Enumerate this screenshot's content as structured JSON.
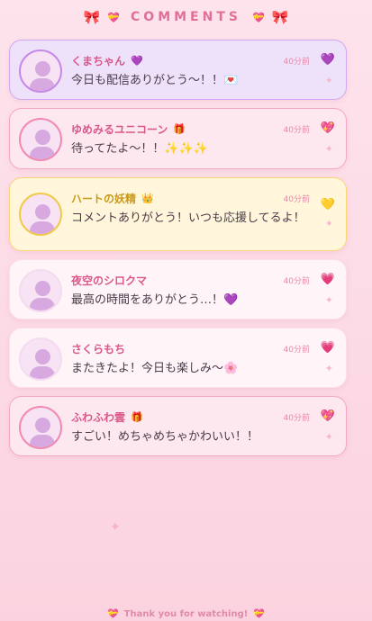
{
  "header": {
    "title": "COMMENTS",
    "left_ribbon": "🎀",
    "right_ribbon": "🎀",
    "left_heart": "💝",
    "right_heart": "💝"
  },
  "comments": [
    {
      "name": "くまちゃん",
      "badge": "💜",
      "time": "40分前",
      "message": "今日も配信ありがとう〜！！💌",
      "reaction": "💜",
      "bg": "#eee2fb",
      "border": "#cfa8f0",
      "ring": "#c58ae8"
    },
    {
      "name": "ゆめみるユニコーン",
      "badge": "🎁",
      "time": "40分前",
      "message": "待ってたよ〜！！✨✨✨",
      "reaction": "💖",
      "bg": "#fde8f0",
      "border": "#f5a8c3",
      "ring": "#f08ab0"
    },
    {
      "name": "ハートの妖精",
      "badge": "👑",
      "time": "40分前",
      "message": "コメントありがとう！いつも応援してるよ！",
      "reaction": "💛",
      "bg": "#fff6dc",
      "border": "#f6d774",
      "ring": "#f1c94a",
      "name_color": "#c99a1a"
    },
    {
      "name": "夜空のシロクマ",
      "badge": "",
      "time": "40分前",
      "message": "最高の時間をありがとう…！💜",
      "reaction": "💗",
      "bg": "#fff4f8",
      "border": "#fbe0ea",
      "ring": "#f3dcef"
    },
    {
      "name": "さくらもち",
      "badge": "",
      "time": "40分前",
      "message": "またきたよ！今日も楽しみ〜🌸",
      "reaction": "💗",
      "bg": "#fff4f8",
      "border": "#fbe0ea",
      "ring": "#f3dcef"
    },
    {
      "name": "ふわふわ雲",
      "badge": "🎁",
      "time": "40分前",
      "message": "すごい！めちゃめちゃかわいい！！",
      "reaction": "💖",
      "bg": "#fde8f0",
      "border": "#f5a8c3",
      "ring": "#f08ab0"
    }
  ],
  "footer": {
    "text": "Thank you for watching!",
    "left_icon": "💝",
    "right_icon": "💝"
  }
}
